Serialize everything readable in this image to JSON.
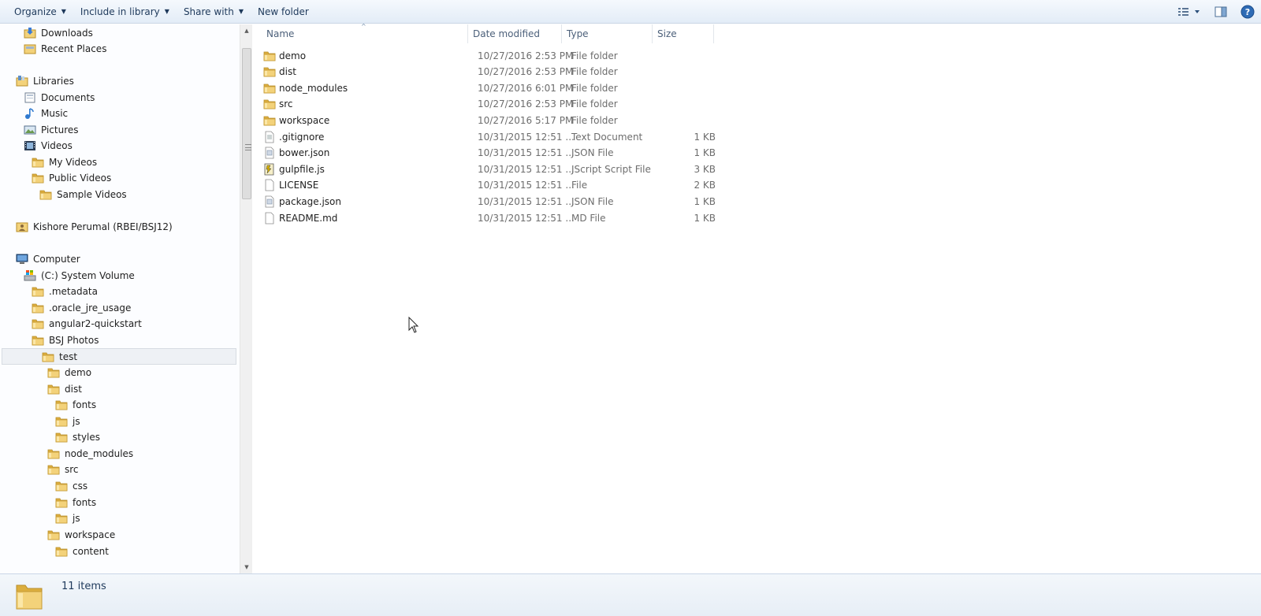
{
  "toolbar": {
    "organize": "Organize",
    "include_in_library": "Include in library",
    "share_with": "Share with",
    "new_folder": "New folder",
    "right_icons": [
      "view-options-icon",
      "preview-pane-icon",
      "help-icon"
    ]
  },
  "nav": {
    "items": [
      {
        "label": "Downloads",
        "icon": "downloads-folder-icon",
        "indent": 1
      },
      {
        "label": "Recent Places",
        "icon": "recent-places-icon",
        "indent": 1
      },
      {
        "label": "Libraries",
        "icon": "libraries-icon",
        "indent": 0
      },
      {
        "label": "Documents",
        "icon": "documents-library-icon",
        "indent": 1
      },
      {
        "label": "Music",
        "icon": "music-library-icon",
        "indent": 1
      },
      {
        "label": "Pictures",
        "icon": "pictures-library-icon",
        "indent": 1
      },
      {
        "label": "Videos",
        "icon": "videos-library-icon",
        "indent": 1
      },
      {
        "label": "My Videos",
        "icon": "folder-icon",
        "indent": 2
      },
      {
        "label": "Public Videos",
        "icon": "folder-icon",
        "indent": 2
      },
      {
        "label": "Sample Videos",
        "icon": "folder-icon",
        "indent": 3
      },
      {
        "label": "Kishore Perumal (RBEI/BSJ12)",
        "icon": "user-folder-icon",
        "indent": 0
      },
      {
        "label": "Computer",
        "icon": "computer-icon",
        "indent": 0
      },
      {
        "label": "(C:) System Volume",
        "icon": "drive-icon",
        "indent": 1
      },
      {
        "label": ".metadata",
        "icon": "folder-icon",
        "indent": 2
      },
      {
        "label": ".oracle_jre_usage",
        "icon": "folder-icon",
        "indent": 2
      },
      {
        "label": "angular2-quickstart",
        "icon": "folder-icon",
        "indent": 2
      },
      {
        "label": "BSJ Photos",
        "icon": "folder-icon",
        "indent": 2
      },
      {
        "label": "test",
        "icon": "folder-icon",
        "indent": 3,
        "selected": true
      },
      {
        "label": "demo",
        "icon": "folder-icon",
        "indent": 4
      },
      {
        "label": "dist",
        "icon": "folder-icon",
        "indent": 4
      },
      {
        "label": "fonts",
        "icon": "folder-icon",
        "indent": 5
      },
      {
        "label": "js",
        "icon": "folder-icon",
        "indent": 5
      },
      {
        "label": "styles",
        "icon": "folder-icon",
        "indent": 5
      },
      {
        "label": "node_modules",
        "icon": "folder-icon",
        "indent": 4
      },
      {
        "label": "src",
        "icon": "folder-icon",
        "indent": 4
      },
      {
        "label": "css",
        "icon": "folder-icon",
        "indent": 5
      },
      {
        "label": "fonts",
        "icon": "folder-icon",
        "indent": 5
      },
      {
        "label": "js",
        "icon": "folder-icon",
        "indent": 5
      },
      {
        "label": "workspace",
        "icon": "folder-icon",
        "indent": 4
      },
      {
        "label": "content",
        "icon": "folder-icon",
        "indent": 5
      }
    ]
  },
  "columns": {
    "name": "Name",
    "date": "Date modified",
    "type": "Type",
    "size": "Size"
  },
  "files": [
    {
      "name": "demo",
      "date": "10/27/2016 2:53 PM",
      "type": "File folder",
      "size": "",
      "icon": "folder-icon"
    },
    {
      "name": "dist",
      "date": "10/27/2016 2:53 PM",
      "type": "File folder",
      "size": "",
      "icon": "folder-icon"
    },
    {
      "name": "node_modules",
      "date": "10/27/2016 6:01 PM",
      "type": "File folder",
      "size": "",
      "icon": "folder-icon"
    },
    {
      "name": "src",
      "date": "10/27/2016 2:53 PM",
      "type": "File folder",
      "size": "",
      "icon": "folder-icon"
    },
    {
      "name": "workspace",
      "date": "10/27/2016 5:17 PM",
      "type": "File folder",
      "size": "",
      "icon": "folder-icon"
    },
    {
      "name": ".gitignore",
      "date": "10/31/2015 12:51 ...",
      "type": "Text Document",
      "size": "1 KB",
      "icon": "text-file-icon"
    },
    {
      "name": "bower.json",
      "date": "10/31/2015 12:51 ...",
      "type": "JSON File",
      "size": "1 KB",
      "icon": "json-file-icon"
    },
    {
      "name": "gulpfile.js",
      "date": "10/31/2015 12:51 ...",
      "type": "JScript Script File",
      "size": "3 KB",
      "icon": "script-file-icon"
    },
    {
      "name": "LICENSE",
      "date": "10/31/2015 12:51 ...",
      "type": "File",
      "size": "2 KB",
      "icon": "blank-file-icon"
    },
    {
      "name": "package.json",
      "date": "10/31/2015 12:51 ...",
      "type": "JSON File",
      "size": "1 KB",
      "icon": "json-file-icon"
    },
    {
      "name": "README.md",
      "date": "10/31/2015 12:51 ...",
      "type": "MD File",
      "size": "1 KB",
      "icon": "blank-file-icon"
    }
  ],
  "status": {
    "item_count": "11 items"
  },
  "colors": {
    "toolbar_text": "#1e395b",
    "folder_yellow": "#e8c15a",
    "header_text": "#4c607a",
    "secondary_text": "#6d6d6d"
  }
}
